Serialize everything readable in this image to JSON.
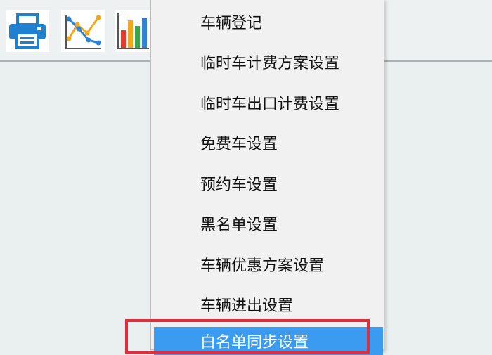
{
  "toolbar": {
    "buttons": [
      {
        "icon": "printer-icon"
      },
      {
        "icon": "line-chart-icon"
      },
      {
        "icon": "bar-chart-icon"
      }
    ]
  },
  "menu": {
    "items": [
      {
        "label": "车辆登记"
      },
      {
        "label": "临时车计费方案设置"
      },
      {
        "label": "临时车出口计费设置"
      },
      {
        "label": "免费车设置"
      },
      {
        "label": "预约车设置"
      },
      {
        "label": "黑名单设置"
      },
      {
        "label": "车辆优惠方案设置"
      },
      {
        "label": "车辆进出设置"
      },
      {
        "label": "白名单同步设置"
      }
    ],
    "selected_index": 8
  },
  "colors": {
    "menu_background": "#f1f1f1",
    "selected_background": "#3a9bf0",
    "highlight_border": "#e12d3b",
    "workspace_background": "#e9f0ef"
  }
}
